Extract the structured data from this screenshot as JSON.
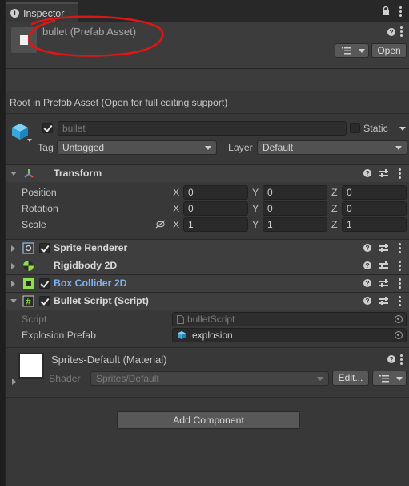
{
  "tab": {
    "label": "Inspector"
  },
  "header": {
    "title": "bullet (Prefab Asset)",
    "open_label": "Open"
  },
  "root_note": "Root in Prefab Asset (Open for full editing support)",
  "gameobject": {
    "name_value": "bullet",
    "static_label": "Static",
    "tag_label": "Tag",
    "tag_value": "Untagged",
    "layer_label": "Layer",
    "layer_value": "Default"
  },
  "transform": {
    "title": "Transform",
    "position_label": "Position",
    "rotation_label": "Rotation",
    "scale_label": "Scale",
    "axis_x": "X",
    "axis_y": "Y",
    "axis_z": "Z",
    "position": [
      "0",
      "0",
      "0"
    ],
    "rotation": [
      "0",
      "0",
      "0"
    ],
    "scale": [
      "1",
      "1",
      "1"
    ]
  },
  "components": {
    "sprite_renderer": "Sprite Renderer",
    "rigidbody": "Rigidbody 2D",
    "box_collider": "Box Collider 2D",
    "bullet_script": "Bullet Script (Script)"
  },
  "bullet_script": {
    "script_label": "Script",
    "script_value": "bulletScript",
    "explosion_label": "Explosion Prefab",
    "explosion_value": "explosion"
  },
  "material": {
    "title": "Sprites-Default (Material)",
    "shader_label": "Shader",
    "shader_value": "Sprites/Default",
    "edit_label": "Edit..."
  },
  "add_component_label": "Add Component",
  "colors": {
    "annotation_circle": "#e01515",
    "link_blue": "#7fb2f0",
    "panel_bg": "#383838"
  }
}
